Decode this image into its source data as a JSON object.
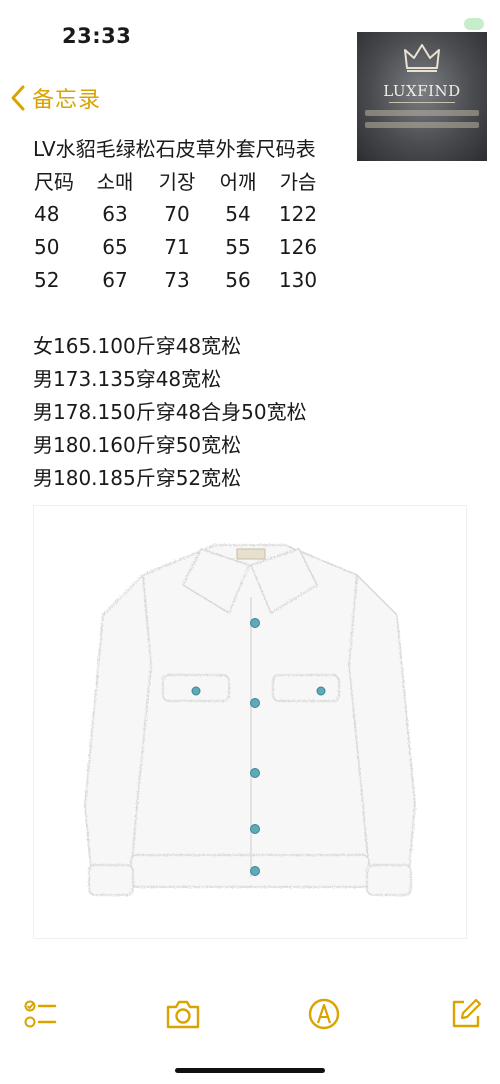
{
  "status_bar": {
    "time": "23:33"
  },
  "nav": {
    "back_label": "备忘录"
  },
  "watermark": {
    "brand": "LUXFIND"
  },
  "note": {
    "title": "LV水貂毛绿松石皮草外套尺码表",
    "size_table": {
      "headers": [
        "尺码",
        "소매",
        "기장",
        "어깨",
        "가슴"
      ],
      "rows": [
        [
          "48",
          "63",
          "70",
          "54",
          "122"
        ],
        [
          "50",
          "65",
          "71",
          "55",
          "126"
        ],
        [
          "52",
          "67",
          "73",
          "56",
          "130"
        ]
      ]
    },
    "fit_notes": [
      "女165.100斤穿48宽松",
      "男173.135穿48宽松",
      "男178.150斤穿48合身50宽松",
      "男180.160斤穿50宽松",
      "男180.185斤穿52宽松"
    ]
  },
  "toolbar": {
    "icons": [
      "checklist-icon",
      "camera-icon",
      "markup-pen-icon",
      "compose-icon"
    ]
  },
  "colors": {
    "accent": "#d9a400",
    "garment": "#f6f6f6",
    "buttons": "#5fa9b8"
  }
}
